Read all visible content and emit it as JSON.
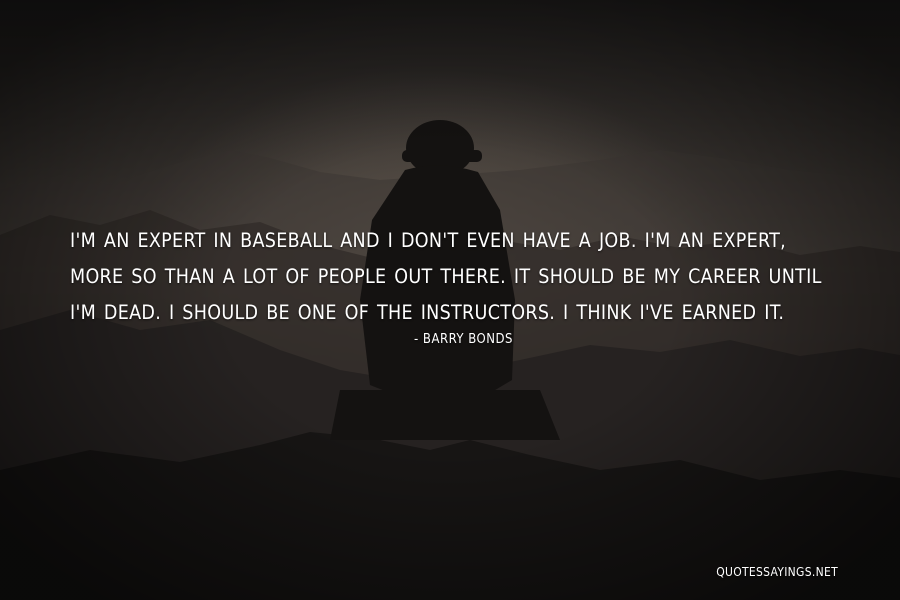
{
  "quote": {
    "text": "I'm an expert in baseball and I don't even have a job. I'm an expert, more so than a lot of people out there. It should be my career until I'm dead. I should be one of the instructors. I think I've earned it.",
    "author": "- Barry Bonds"
  },
  "watermark": {
    "site": "QUOTESSAYINGS.NET"
  },
  "colors": {
    "text": "#ffffff",
    "background_dark": "#1c1a19",
    "background_glow": "#4a433e"
  }
}
